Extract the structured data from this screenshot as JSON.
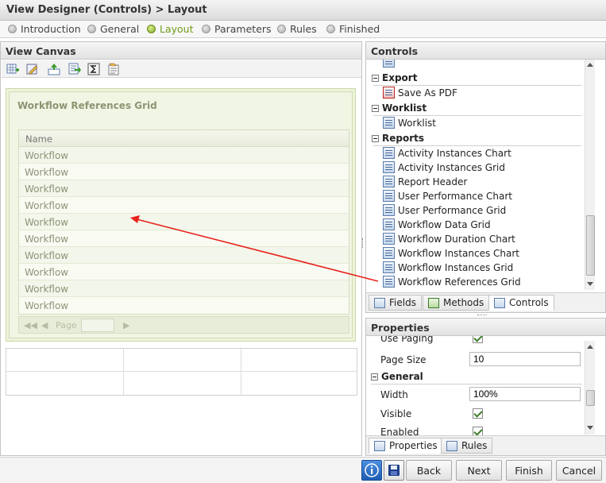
{
  "window": {
    "title": "View Designer (Controls) > Layout"
  },
  "steps": [
    {
      "label": "Introduction",
      "active": false
    },
    {
      "label": "General",
      "active": false
    },
    {
      "label": "Layout",
      "active": true
    },
    {
      "label": "Parameters",
      "active": false
    },
    {
      "label": "Rules",
      "active": false
    },
    {
      "label": "Finished",
      "active": false
    }
  ],
  "canvas": {
    "title": "View Canvas",
    "toolbar_icons": [
      "add-table-icon",
      "edit-layout-icon",
      "move-up-icon",
      "insert-icon",
      "sum-icon",
      "properties-icon"
    ],
    "grid": {
      "title": "Workflow References Grid",
      "column": "Name",
      "rows": [
        "Workflow",
        "Workflow",
        "Workflow",
        "Workflow",
        "Workflow",
        "Workflow",
        "Workflow",
        "Workflow",
        "Workflow",
        "Workflow"
      ],
      "pager_label": "Page"
    }
  },
  "controls": {
    "title": "Controls",
    "categories": [
      {
        "name": "Export",
        "items": [
          "Save As PDF"
        ]
      },
      {
        "name": "Worklist",
        "items": [
          "Worklist"
        ]
      },
      {
        "name": "Reports",
        "items": [
          "Activity Instances Chart",
          "Activity Instances Grid",
          "Report Header",
          "User Performance Chart",
          "User Performance Grid",
          "Workflow Data Grid",
          "Workflow Duration Chart",
          "Workflow Instances Chart",
          "Workflow Instances Grid",
          "Workflow References Grid"
        ]
      }
    ],
    "tabs": [
      "Fields",
      "Methods",
      "Controls"
    ]
  },
  "properties": {
    "title": "Properties",
    "partial_top_label": "Use Paging",
    "page_size_label": "Page Size",
    "page_size_value": "10",
    "section_general": "General",
    "width_label": "Width",
    "width_value": "100%",
    "visible_label": "Visible",
    "enabled_label": "Enabled",
    "tabs": [
      "Properties",
      "Rules"
    ]
  },
  "footer": {
    "info_icon": "info-icon",
    "save_icon": "save-icon",
    "back": "Back",
    "next": "Next",
    "finish": "Finish",
    "cancel": "Cancel"
  },
  "colors": {
    "accent_green": "#7ea72a",
    "arrow_red": "#e8241c",
    "info_blue": "#2c6fc4"
  }
}
